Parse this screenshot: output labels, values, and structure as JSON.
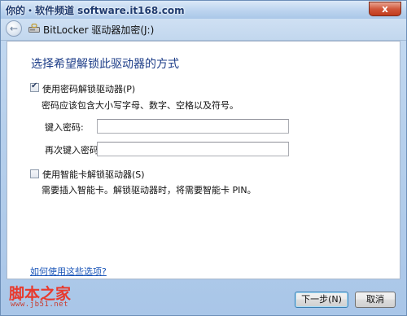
{
  "titlebar": {
    "watermark": "你的・软件频道 software.it168.com",
    "close_label": "x"
  },
  "navbar": {
    "back_glyph": "←",
    "title": "BitLocker 驱动器加密(J:)"
  },
  "main": {
    "heading": "选择希望解锁此驱动器的方式",
    "password_option": {
      "label": "使用密码解锁驱动器(P)",
      "checked": true,
      "hint": "密码应该包含大小写字母、数字、空格以及符号。",
      "enter_label": "键入密码:",
      "enter_value": "",
      "reenter_label": "再次键入密码:",
      "reenter_value": ""
    },
    "smartcard_option": {
      "label": "使用智能卡解锁驱动器(S)",
      "checked": false,
      "hint": "需要插入智能卡。解锁驱动器时，将需要智能卡 PIN。"
    },
    "help_link": "如何使用这些选项?"
  },
  "footer": {
    "site_logo": "脚本之家",
    "site_url": "www.jb51.net",
    "next_label": "下一步(N)",
    "cancel_label": "取消"
  },
  "colors": {
    "heading": "#1d3d88",
    "link": "#1a55b8",
    "logo": "#e83a2d"
  }
}
